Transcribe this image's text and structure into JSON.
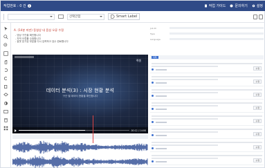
{
  "topbar": {
    "work_label": "작업번호 : 0 건",
    "guide_label": "작업 가이드",
    "inquiry_label": "문의하기",
    "settings_label": "설정"
  },
  "toolbar": {
    "select_left_value": "",
    "select_mid_value": "선택안함",
    "smart_label": "Smart Label"
  },
  "task": {
    "title": "A. (14분 미만) 동영상 내 음성 오류 수정",
    "lines": [
      "- 영상 구간을 확인합니다",
      "- 자막 오류를 수정합니다",
      "- 잘못 표기된 부분을 다시 입력하고 검수 완료합니다"
    ]
  },
  "video": {
    "brand": "엑셀",
    "caption_main": "데이터 분석(3) : 시장 현황 분석",
    "caption_sub": "구간 별 데이터 현황을 확인합니다",
    "time": "00:12 / 14:00",
    "progress": 0.6
  },
  "waveform": {
    "label": "waveform"
  },
  "right": {
    "meta": [
      {
        "k": "Job ID",
        "v": ""
      },
      {
        "k": "Type",
        "v": ""
      },
      {
        "k": "Language",
        "v": ""
      }
    ],
    "list_tag": "자막",
    "edit_label": "수정",
    "segment_count": 8
  },
  "colors": {
    "topbar": "#2f4a87",
    "accent": "#3c6fcf",
    "alert": "#c0392b"
  },
  "icons": [
    "file-icon",
    "help-icon",
    "gear-icon",
    "monitor-icon",
    "tag-icon",
    "pointer-icon",
    "zoom-in-icon",
    "zoom-out-icon",
    "fit-icon",
    "hand-icon",
    "undo-icon",
    "redo-icon",
    "copy-icon",
    "delete-icon",
    "image-icon",
    "layers-icon"
  ]
}
